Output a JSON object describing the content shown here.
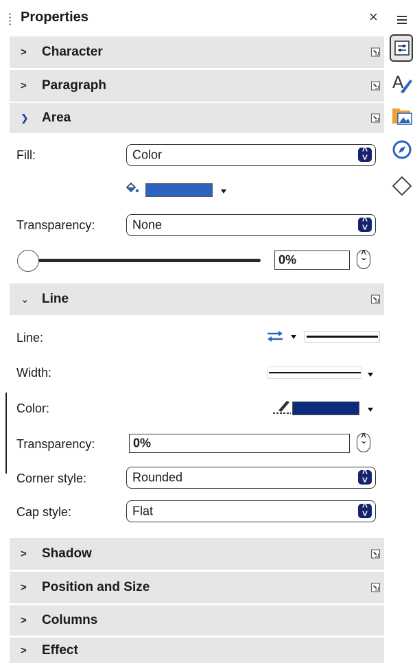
{
  "panel": {
    "title": "Properties",
    "close_symbol": "×"
  },
  "sections": {
    "character": "Character",
    "paragraph": "Paragraph",
    "area": "Area",
    "line": "Line",
    "shadow": "Shadow",
    "position_size": "Position and Size",
    "columns": "Columns",
    "effect": "Effect"
  },
  "area": {
    "fill_label": "Fill:",
    "fill_value": "Color",
    "fill_color": "#2a63c0",
    "transparency_label": "Transparency:",
    "transparency_value": "None",
    "slider_value": "0%"
  },
  "line": {
    "line_label": "Line:",
    "width_label": "Width:",
    "color_label": "Color:",
    "line_color": "#0c2b7a",
    "transparency_label": "Transparency:",
    "transparency_value": "0%",
    "corner_label": "Corner style:",
    "corner_value": "Rounded",
    "cap_label": "Cap style:",
    "cap_value": "Flat"
  },
  "tabbar": {
    "icons": [
      "menu-icon",
      "properties-icon",
      "styles-icon",
      "gallery-icon",
      "navigator-icon",
      "shapes-icon"
    ]
  }
}
